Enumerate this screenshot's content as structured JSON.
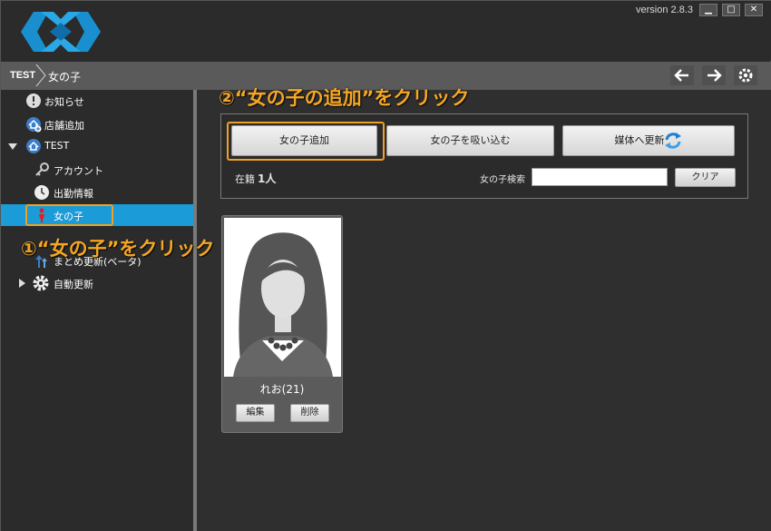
{
  "window": {
    "version": "version 2.8.3",
    "controls": {
      "minimize": "▁",
      "maximize": "□",
      "close": "✕"
    }
  },
  "breadcrumb": {
    "root": "TEST",
    "current": "女の子"
  },
  "toolbar": {
    "back_icon": "arrow-left-icon",
    "forward_icon": "arrow-right-icon",
    "settings_icon": "gear-icon"
  },
  "sidebar": {
    "items": [
      {
        "label": "お知らせ",
        "icon": "info-icon"
      },
      {
        "label": "店舗追加",
        "icon": "add-home-icon"
      },
      {
        "label": "TEST",
        "icon": "home-icon"
      },
      {
        "label": "アカウント",
        "icon": "key-icon"
      },
      {
        "label": "出勤情報",
        "icon": "clock-icon"
      },
      {
        "label": "女の子",
        "icon": "person-icon"
      },
      {
        "label": "まとめ更新(ベータ)",
        "icon": "upload-icon"
      },
      {
        "label": "自動更新",
        "icon": "gear-icon"
      }
    ]
  },
  "annotations": {
    "step1": "①“女の子”をクリック",
    "step2": "②“女の子の追加”をクリック"
  },
  "main": {
    "add_button": "女の子追加",
    "import_button": "女の子を吸い込む",
    "media_update_button": "媒体へ更新",
    "enrolled_label": "在籍",
    "enrolled_count": "1人",
    "search_label": "女の子検索",
    "search_value": "",
    "clear_button": "クリア"
  },
  "cards": [
    {
      "name": "れお(21)",
      "edit": "編集",
      "delete": "削除"
    }
  ],
  "colors": {
    "accent": "#1b9bd7",
    "annotation": "#f5a623",
    "background": "#2b2b2b"
  }
}
